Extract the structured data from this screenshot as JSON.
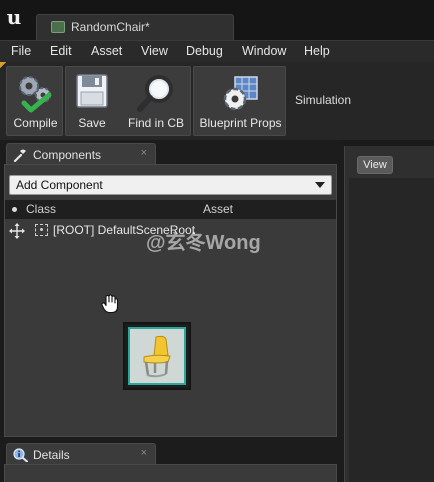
{
  "app": {
    "logo_glyph": "u",
    "document_tab": "RandomChair*"
  },
  "menu": [
    "File",
    "Edit",
    "Asset",
    "View",
    "Debug",
    "Window",
    "Help"
  ],
  "toolbar": {
    "compile": "Compile",
    "save": "Save",
    "find_in_cb": "Find in CB",
    "blueprint_props": "Blueprint Props",
    "simulation": "Simulation"
  },
  "components_panel": {
    "tab_label": "Components",
    "close_glyph": "×",
    "add_component": "Add Component",
    "col_class": "Class",
    "col_asset": "Asset",
    "root_row": "[ROOT] DefaultSceneRoot"
  },
  "details_panel": {
    "tab_label": "Details",
    "close_glyph": "×"
  },
  "viewport": {
    "view_button": "View"
  },
  "watermark": "@玄冬Wong",
  "colors": {
    "panel_bg": "#3a3a3a",
    "toolbar_bg": "#3c3c3c",
    "thumbnail_border": "#2aa79b",
    "accent": "#d6a12c"
  },
  "icons": {
    "compile": "gear-check-icon",
    "save": "floppy-disk-icon",
    "find_in_cb": "magnifier-icon",
    "blueprint_props": "gear-grid-icon",
    "components_tab": "wrench-icon",
    "details_tab": "info-magnifier-icon",
    "cursor": "hand-cursor-icon"
  }
}
